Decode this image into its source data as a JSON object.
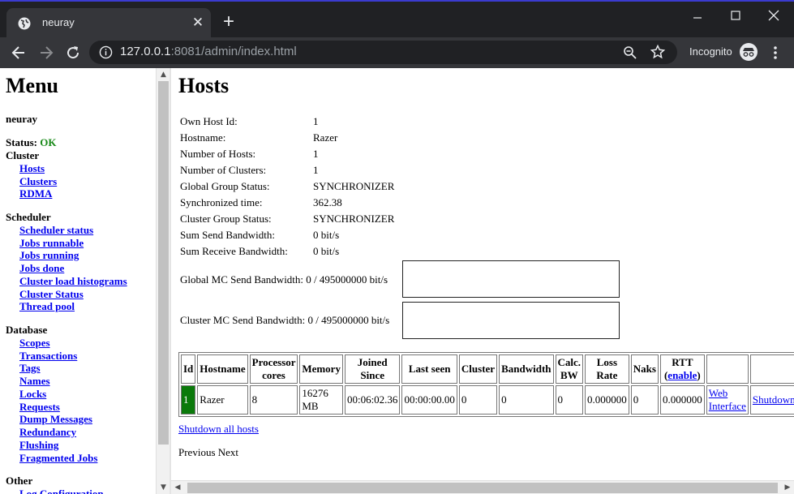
{
  "browser": {
    "tab_title": "neuray",
    "url_host": "127.0.0.1",
    "url_rest": ":8081/admin/index.html",
    "incognito_label": "Incognito"
  },
  "menu": {
    "title": "Menu",
    "product": "neuray",
    "status_label": "Status:",
    "status_value": "OK",
    "sections": [
      {
        "title": "Cluster",
        "items": [
          "Hosts",
          "Clusters",
          "RDMA"
        ]
      },
      {
        "title": "Scheduler",
        "items": [
          "Scheduler status",
          "Jobs runnable",
          "Jobs running",
          "Jobs done",
          "Cluster load histograms",
          "Cluster Status",
          "Thread pool"
        ]
      },
      {
        "title": "Database",
        "items": [
          "Scopes",
          "Transactions",
          "Tags",
          "Names",
          "Locks",
          "Requests",
          "Dump Messages",
          "Redundancy",
          "Flushing",
          "Fragmented Jobs"
        ]
      },
      {
        "title": "Other",
        "items": [
          "Log Configuration"
        ]
      }
    ]
  },
  "hosts": {
    "title": "Hosts",
    "info": [
      {
        "key": "Own Host Id:",
        "value": "1"
      },
      {
        "key": "Hostname:",
        "value": "Razer"
      },
      {
        "key": "Number of Hosts:",
        "value": "1"
      },
      {
        "key": "Number of Clusters:",
        "value": "1"
      },
      {
        "key": "Global Group Status:",
        "value": "SYNCHRONIZER"
      },
      {
        "key": "Synchronized time:",
        "value": "362.38"
      },
      {
        "key": "Cluster Group Status:",
        "value": "SYNCHRONIZER"
      },
      {
        "key": "Sum Send Bandwidth:",
        "value": "0 bit/s"
      },
      {
        "key": "Sum Receive Bandwidth:",
        "value": "0 bit/s"
      }
    ],
    "global_mc": {
      "label": "Global MC Send Bandwidth:",
      "value": "0 / 495000000 bit/s"
    },
    "cluster_mc": {
      "label": "Cluster MC Send Bandwidth:",
      "value": "0 / 495000000 bit/s"
    },
    "table": {
      "headers": [
        "Id",
        "Hostname",
        "Processor cores",
        "Memory",
        "Joined Since",
        "Last seen",
        "Cluster",
        "Bandwidth",
        "Calc. BW",
        "Loss Rate",
        "Naks",
        "RTT",
        "",
        ""
      ],
      "rtt_link": "enable",
      "rows": [
        {
          "id": "1",
          "hostname": "Razer",
          "cores": "8",
          "memory": "16276 MB",
          "joined": "00:06:02.36",
          "last_seen": "00:00:00.00",
          "cluster": "0",
          "bandwidth": "0",
          "calc_bw": "0",
          "loss_rate": "0.000000",
          "naks": "0",
          "rtt": "0.000000",
          "web": "Web Interface",
          "shutdown": "Shutdown"
        }
      ]
    },
    "shutdown_all": "Shutdown all hosts",
    "pager_prev": "Previous",
    "pager_next": "Next"
  }
}
